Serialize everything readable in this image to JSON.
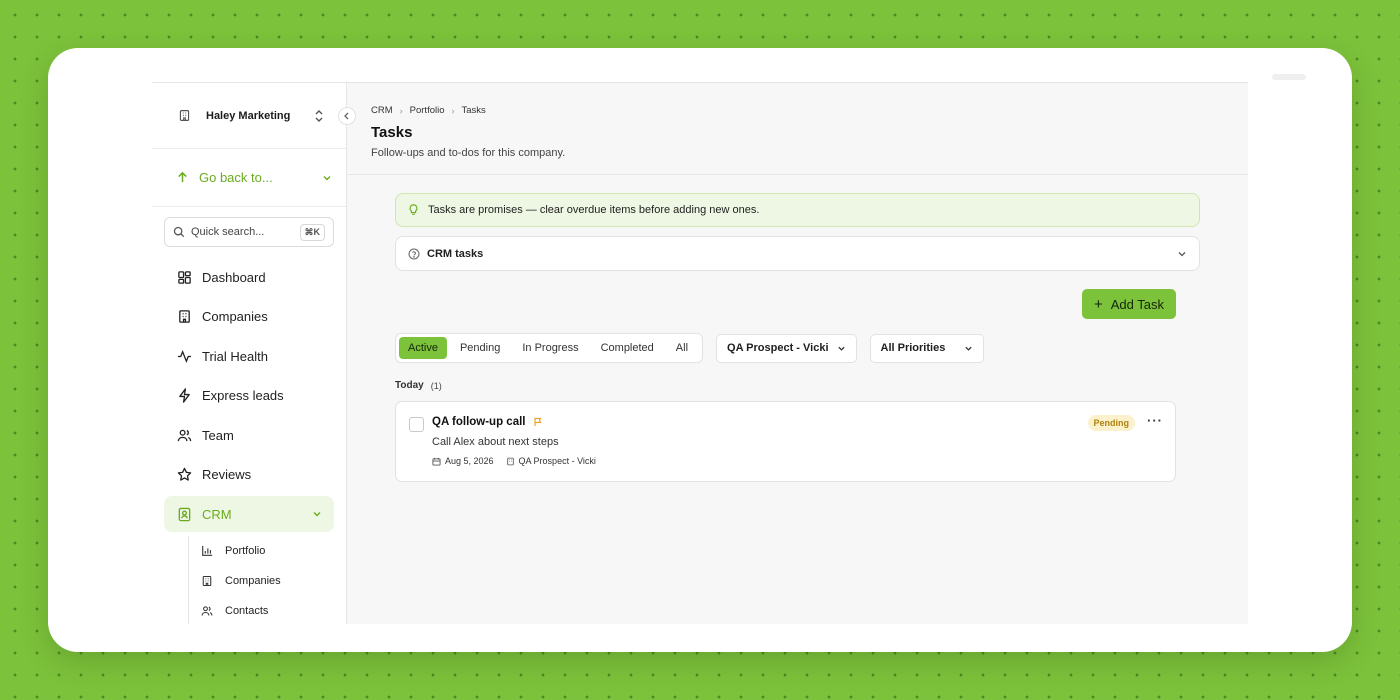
{
  "org": {
    "name": "Haley Marketing"
  },
  "sidebar": {
    "go_back": "Go back to...",
    "search": {
      "placeholder": "Quick search...",
      "shortcut": "⌘K"
    },
    "items": [
      {
        "label": "Dashboard",
        "icon": "dashboard-icon"
      },
      {
        "label": "Companies",
        "icon": "building-icon"
      },
      {
        "label": "Trial Health",
        "icon": "activity-icon"
      },
      {
        "label": "Express leads",
        "icon": "lightning-icon"
      },
      {
        "label": "Team",
        "icon": "users-icon"
      },
      {
        "label": "Reviews",
        "icon": "star-icon"
      },
      {
        "label": "CRM",
        "icon": "contact-icon",
        "active": true
      }
    ],
    "crm_sub": [
      {
        "label": "Portfolio",
        "icon": "bar-chart-icon"
      },
      {
        "label": "Companies",
        "icon": "building-icon"
      },
      {
        "label": "Contacts",
        "icon": "users-icon"
      }
    ]
  },
  "breadcrumb": [
    "CRM",
    "Portfolio",
    "Tasks"
  ],
  "page": {
    "title": "Tasks",
    "subtitle": "Follow-ups and to-dos for this company."
  },
  "tip": "Tasks are promises — clear overdue items before adding new ones.",
  "accordion": {
    "label": "CRM tasks"
  },
  "add_task_label": "Add Task",
  "filters": {
    "status_tabs": [
      "Active",
      "Pending",
      "In Progress",
      "Completed",
      "All"
    ],
    "active_tab": "Active",
    "contact": "QA Prospect - Vicki",
    "priority": "All Priorities"
  },
  "groups": [
    {
      "label": "Today",
      "count": "(1)",
      "tasks": [
        {
          "title": "QA follow-up call",
          "description": "Call Alex about next steps",
          "date": "Aug 5, 2026",
          "contact": "QA Prospect - Vicki",
          "status": "Pending",
          "more": "···"
        }
      ]
    }
  ],
  "colors": {
    "accent": "#7cc23a",
    "accent_text": "#6aab1f",
    "pending_bg": "#fbf1cc",
    "pending_text": "#b0820f",
    "background": "#7cc23a"
  }
}
